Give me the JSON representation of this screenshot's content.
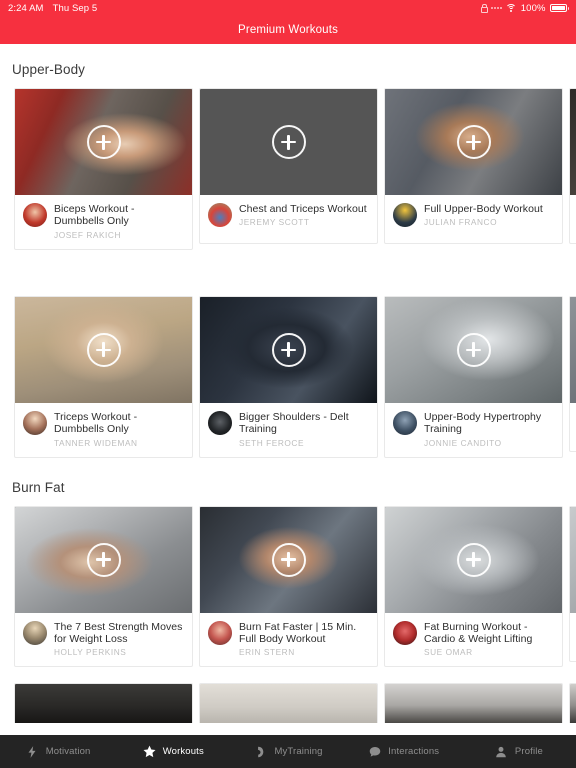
{
  "status_bar": {
    "time": "2:24 AM",
    "date": "Thu Sep 5",
    "battery_percent": "100%",
    "icons": [
      "rotation-lock-icon",
      "signal-dots-icon",
      "wifi-icon",
      "battery-icon"
    ]
  },
  "nav": {
    "title": "Premium Workouts",
    "bar_color": "#F6303F"
  },
  "sections": [
    {
      "title": "Upper-Body",
      "rows": [
        {
          "cards": [
            {
              "title": "Biceps Workout - Dumbbells Only",
              "author": "JOSEF RAKICH",
              "thumb_class": "t1",
              "avatar_class": "a1",
              "play_icon": "plus-circle-play-icon"
            },
            {
              "title": "Chest and Triceps Workout",
              "author": "JEREMY SCOTT",
              "thumb_class": "t2",
              "avatar_class": "a2",
              "play_icon": "plus-circle-play-icon"
            },
            {
              "title": "Full Upper-Body Workout",
              "author": "JULIAN FRANCO",
              "thumb_class": "t3",
              "avatar_class": "a3",
              "play_icon": "plus-circle-play-icon"
            },
            {
              "title": "",
              "author": "",
              "thumb_class": "t4",
              "avatar_class": "a4",
              "play_icon": "plus-circle-play-icon"
            }
          ]
        },
        {
          "cards": [
            {
              "title": "Triceps Workout - Dumbbells Only",
              "author": "TANNER WIDEMAN",
              "thumb_class": "t5",
              "avatar_class": "a5",
              "play_icon": "plus-circle-play-icon"
            },
            {
              "title": "Bigger Shoulders - Delt Training",
              "author": "SETH FEROCE",
              "thumb_class": "t6",
              "avatar_class": "a6",
              "play_icon": "plus-circle-play-icon"
            },
            {
              "title": "Upper-Body Hypertrophy Training",
              "author": "JONNIE CANDITO",
              "thumb_class": "t7",
              "avatar_class": "a7",
              "play_icon": "plus-circle-play-icon"
            },
            {
              "title": "",
              "author": "",
              "thumb_class": "t8",
              "avatar_class": "a8",
              "play_icon": "plus-circle-play-icon"
            }
          ]
        }
      ]
    },
    {
      "title": "Burn Fat",
      "rows": [
        {
          "cards": [
            {
              "title": "The 7 Best Strength Moves for Weight Loss",
              "author": "HOLLY PERKINS",
              "thumb_class": "t9",
              "avatar_class": "a9",
              "play_icon": "plus-circle-play-icon"
            },
            {
              "title": "Burn Fat Faster | 15 Min. Full Body Workout",
              "author": "ERIN STERN",
              "thumb_class": "t10",
              "avatar_class": "a10",
              "play_icon": "plus-circle-play-icon"
            },
            {
              "title": "Fat Burning Workout - Cardio & Weight Lifting",
              "author": "SUE OMAR",
              "thumb_class": "t11",
              "avatar_class": "a11",
              "play_icon": "plus-circle-play-icon"
            },
            {
              "title": "",
              "author": "",
              "thumb_class": "t12",
              "avatar_class": "a12",
              "play_icon": "plus-circle-play-icon"
            }
          ]
        }
      ]
    }
  ],
  "teaser_row": {
    "thumbs": [
      "t13",
      "t14",
      "t15",
      "t16"
    ]
  },
  "tabbar": {
    "background": "#242424",
    "items": [
      {
        "label": "Motivation",
        "icon": "lightning-bolt-icon",
        "active": false
      },
      {
        "label": "Workouts",
        "icon": "star-icon",
        "active": true
      },
      {
        "label": "MyTraining",
        "icon": "flexed-biceps-icon",
        "active": false
      },
      {
        "label": "Interactions",
        "icon": "chat-bubble-icon",
        "active": false
      },
      {
        "label": "Profile",
        "icon": "person-icon",
        "active": false
      }
    ]
  }
}
